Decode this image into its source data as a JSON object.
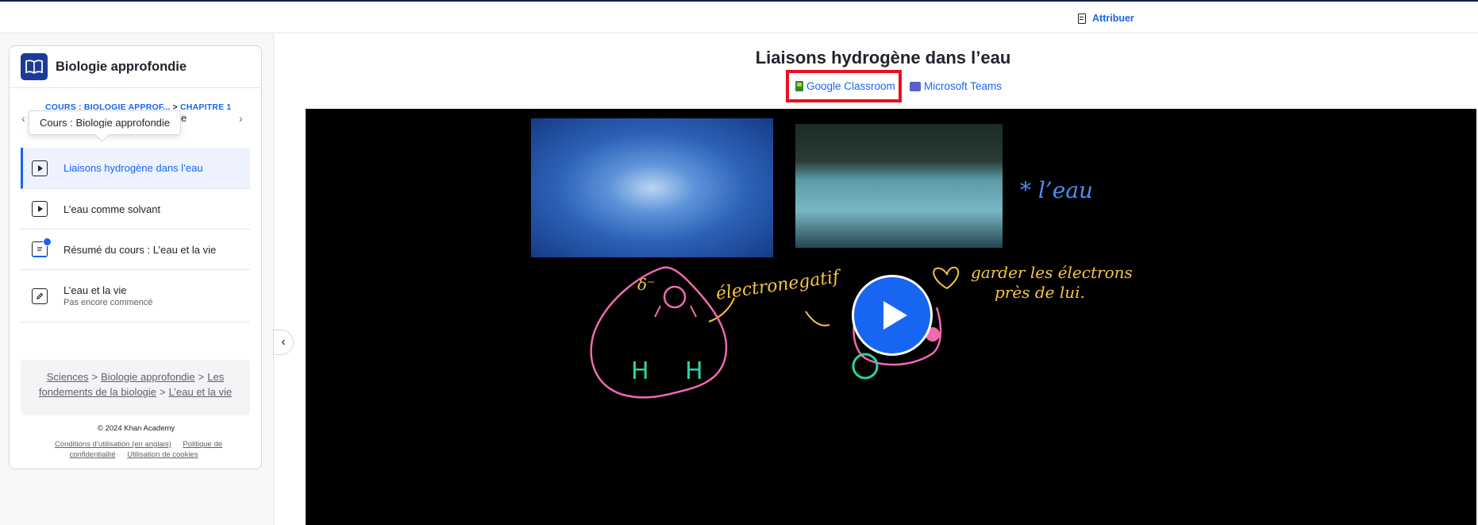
{
  "topbar": {
    "assign_label": "Attribuer",
    "assign_icon": "assignment-icon"
  },
  "sidebar": {
    "course_title": "Biologie approfondie",
    "crumb_course": "COURS : BIOLOGIE APPROF...",
    "crumb_sep": ">",
    "crumb_unit": "CHAPITRE 1",
    "unit_partial": "e",
    "tooltip": "Cours : Biologie approfondie",
    "lessons": [
      {
        "label": "Liaisons hydrogène dans l’eau",
        "type": "video"
      },
      {
        "label": "L’eau comme solvant",
        "type": "video"
      },
      {
        "label": "Résumé du cours : L’eau et la vie",
        "type": "article"
      },
      {
        "label": "L’eau et la vie",
        "sub": "Pas encore commencé",
        "type": "exercise"
      }
    ],
    "breadcrumbs": [
      "Sciences",
      "Biologie approfondie",
      "Les fondements de la biologie",
      "L’eau et la vie"
    ],
    "breadcrumb_sep": ">",
    "copyright": "© 2024 Khan Academy",
    "footer_links": [
      "Conditions d’utilisation (en anglais)",
      "Politique de confidentialité",
      "Utilisation de cookies"
    ]
  },
  "main": {
    "title": "Liaisons hydrogène dans l’eau",
    "share": {
      "google_classroom": "Google Classroom",
      "microsoft_teams": "Microsoft Teams"
    },
    "video_annotations": {
      "delta": "δ⁻",
      "electronegatif": "électronegatif",
      "eau": "* l’eau",
      "garder_line1": "garder les électrons",
      "garder_line2": "près de lui.",
      "h1": "H",
      "h2": "H"
    }
  },
  "colors": {
    "accent": "#1865f2",
    "highlight_box": "#e8101d",
    "annotation_yellow": "#f5c542",
    "annotation_pink": "#f06ab0",
    "annotation_teal": "#2fd1a7"
  }
}
